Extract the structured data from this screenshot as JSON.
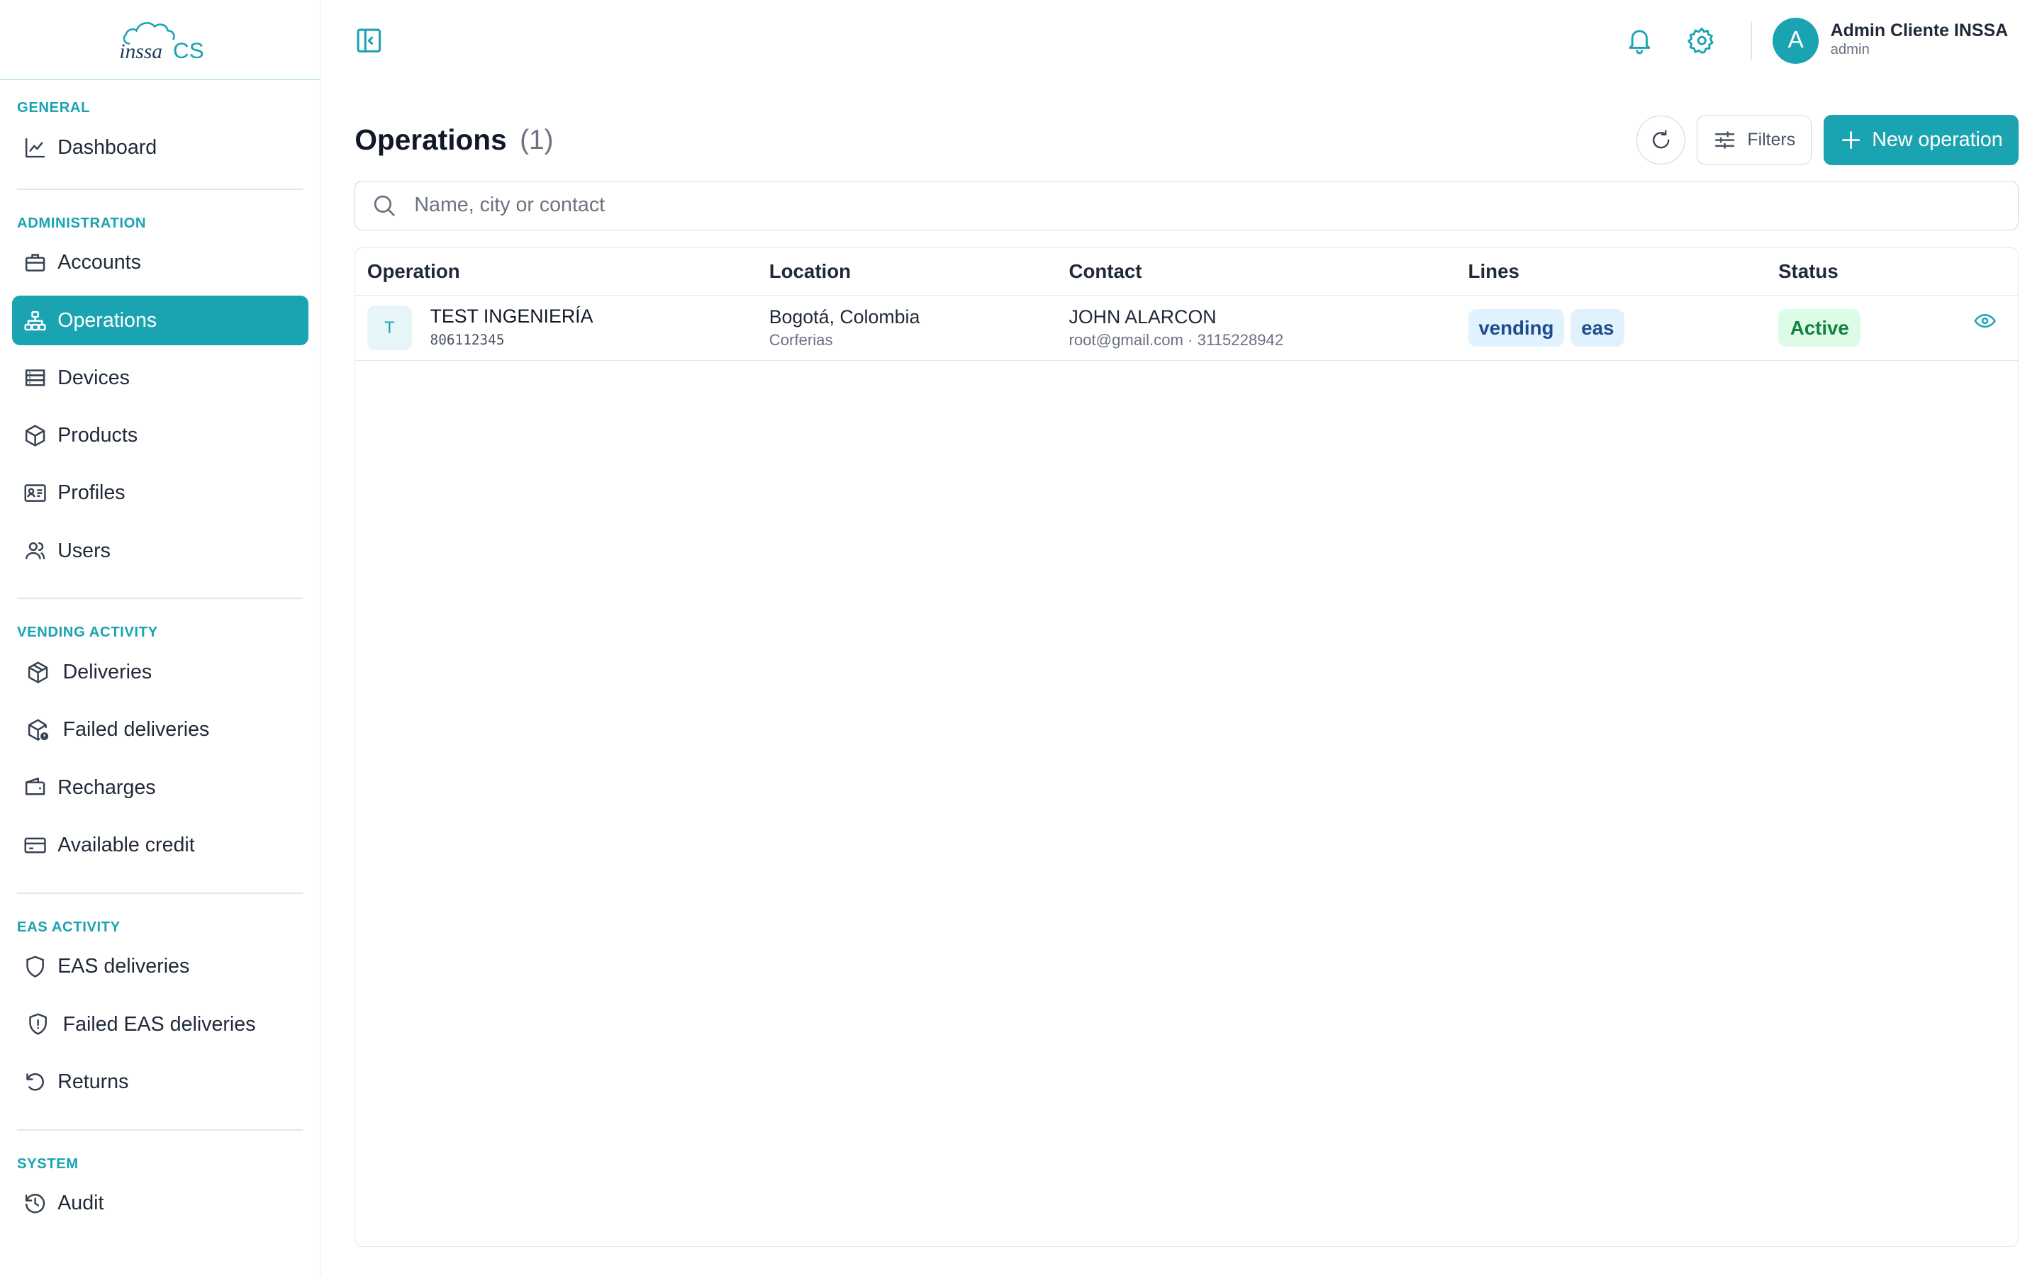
{
  "brand": {
    "logo_text_left": "inssa",
    "logo_text_right": "CS",
    "accent": "#1aa3b1"
  },
  "sidebar": {
    "sections": [
      {
        "label": "GENERAL",
        "items": [
          {
            "label": "Dashboard",
            "icon": "chart-line-icon"
          }
        ]
      },
      {
        "label": "ADMINISTRATION",
        "items": [
          {
            "label": "Accounts",
            "icon": "briefcase-icon"
          },
          {
            "label": "Operations",
            "icon": "org-chart-icon",
            "active": true
          },
          {
            "label": "Devices",
            "icon": "server-icon"
          },
          {
            "label": "Products",
            "icon": "box-icon"
          },
          {
            "label": "Profiles",
            "icon": "id-card-icon"
          },
          {
            "label": "Users",
            "icon": "users-icon"
          }
        ]
      },
      {
        "label": "VENDING ACTIVITY",
        "items": [
          {
            "label": "Deliveries",
            "icon": "package-icon"
          },
          {
            "label": "Failed deliveries",
            "icon": "package-alert-icon"
          },
          {
            "label": "Recharges",
            "icon": "wallet-icon"
          },
          {
            "label": "Available credit",
            "icon": "credit-card-icon"
          }
        ]
      },
      {
        "label": "EAS ACTIVITY",
        "items": [
          {
            "label": "EAS deliveries",
            "icon": "shield-icon"
          },
          {
            "label": "Failed EAS deliveries",
            "icon": "shield-alert-icon"
          },
          {
            "label": "Returns",
            "icon": "rotate-ccw-icon"
          }
        ]
      },
      {
        "label": "SYSTEM",
        "items": [
          {
            "label": "Audit",
            "icon": "history-icon"
          }
        ]
      }
    ]
  },
  "header": {
    "user": {
      "initial": "A",
      "name": "Admin Cliente INSSA",
      "role": "admin"
    }
  },
  "page": {
    "title": "Operations",
    "count": "(1)",
    "filters_label": "Filters",
    "new_label": "New operation",
    "search_placeholder": "Name, city or contact"
  },
  "table": {
    "columns": [
      "Operation",
      "Location",
      "Contact",
      "Lines",
      "Status"
    ],
    "rows": [
      {
        "initial": "T",
        "name": "TEST INGENIERÍA",
        "code": "806112345",
        "city": "Bogotá, Colombia",
        "venue": "Corferias",
        "contact_name": "JOHN ALARCON",
        "contact_detail": "root@gmail.com · 3115228942",
        "lines": [
          "vending",
          "eas"
        ],
        "status": "Active"
      }
    ]
  }
}
